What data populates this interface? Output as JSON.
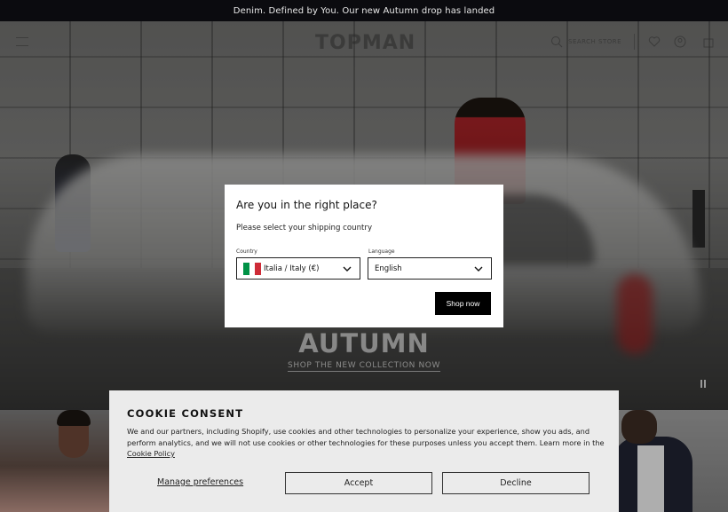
{
  "announcement": {
    "text": "Denim. Defined by You. Our new Autumn drop has landed"
  },
  "header": {
    "logo": "TOPMAN",
    "search_label": "SEARCH STORE"
  },
  "hero": {
    "title": "AUTUMN",
    "link": "SHOP THE NEW COLLECTION NOW"
  },
  "modal": {
    "title": "Are you in the right place?",
    "subtitle": "Please select your shipping country",
    "country_label": "Country",
    "country_value": "Italia / Italy (€)",
    "country_flag_colors": [
      "#009246",
      "#ffffff",
      "#ce2b37"
    ],
    "language_label": "Language",
    "language_value": "English",
    "button": "Shop now"
  },
  "cookie": {
    "title": "COOKIE CONSENT",
    "text": "We and our partners, including Shopify, use cookies and other technologies to personalize your experience, show you ads, and perform analytics, and we will not use cookies or other technologies for these purposes unless you accept them. Learn more in the ",
    "policy_link": "Cookie Policy",
    "manage": "Manage preferences",
    "accept": "Accept",
    "decline": "Decline"
  }
}
